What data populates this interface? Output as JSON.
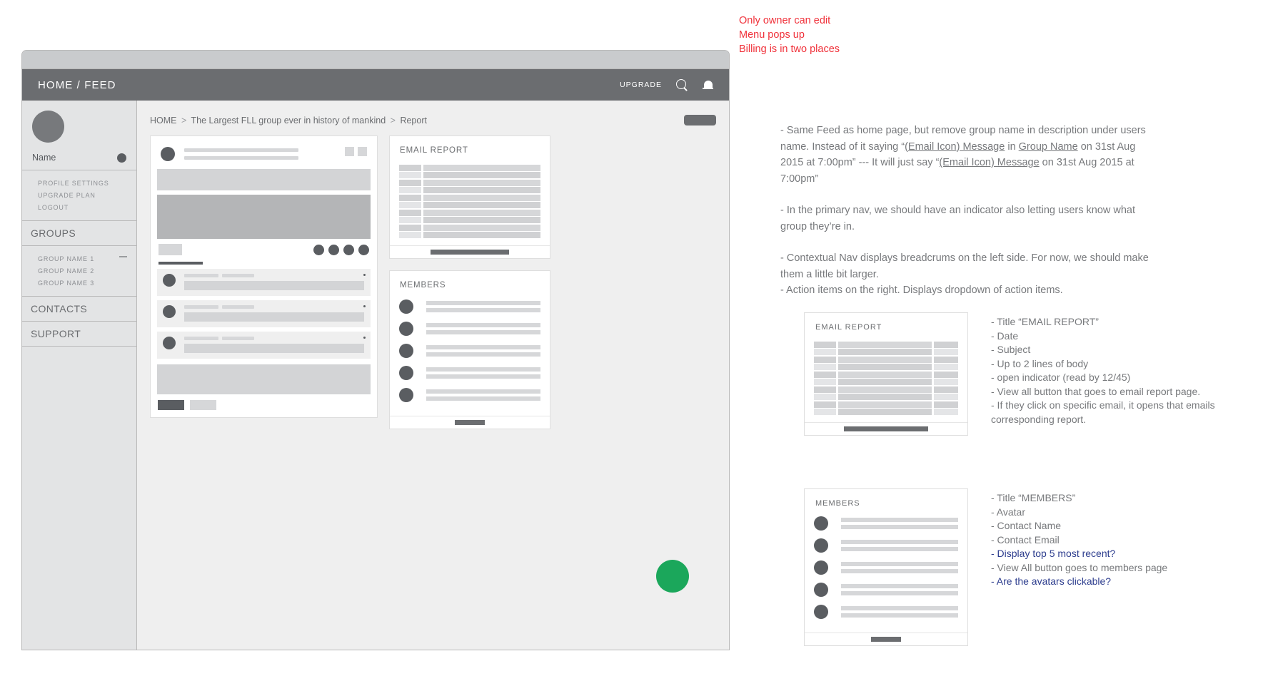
{
  "wireframe": {
    "topbar": {
      "title": "HOME / FEED",
      "upgrade_label": "UPGRADE",
      "search_icon": "search-icon",
      "bell_icon": "bell-icon"
    },
    "sidebar": {
      "profile_name": "Name",
      "account_links": [
        "PROFILE SETTINGS",
        "UPGRADE PLAN",
        "LOGOUT"
      ],
      "groups_heading": "GROUPS",
      "groups": [
        "GROUP NAME 1",
        "GROUP NAME 2",
        "GROUP NAME 3"
      ],
      "sections": [
        "CONTACTS",
        "SUPPORT"
      ]
    },
    "breadcrumb": {
      "home": "HOME",
      "sep": ">",
      "group": "The Largest FLL group ever in history of mankind",
      "page": "Report"
    },
    "panels": {
      "email_report_title": "EMAIL REPORT",
      "members_title": "MEMBERS",
      "email_report_rows": 5,
      "members_rows": 5
    },
    "feed": {
      "comments": 3,
      "reactions": 4
    },
    "fab_color": "#1ba75b"
  },
  "annotations": {
    "red_notes": [
      "Only owner can edit",
      "Menu pops up",
      "Billing is in two places"
    ],
    "main_notes": {
      "p1_a": "- Same Feed as home page, but remove group name in description under users name. Instead of it saying “",
      "p1_u1": "(Email Icon) Message",
      "p1_b": " in ",
      "p1_u2": "Group Name",
      "p1_c": " on 31st Aug 2015 at 7:00pm” --- It will just say “",
      "p1_u3": "(Email Icon) Message",
      "p1_d": " on 31st Aug 2015 at 7:00pm”",
      "p2": "- In the primary nav, we should have an indicator also letting users know what group they’re in.",
      "p3": "- Contextual Nav displays breadcrums on the left side. For now, we should make them a little bit larger.",
      "p4": "- Action items on the right. Displays dropdown of action items."
    },
    "email_report_callout": {
      "card_title": "EMAIL REPORT",
      "items": [
        {
          "text": "- Title “EMAIL REPORT”",
          "highlight": false
        },
        {
          "text": "- Date",
          "highlight": false
        },
        {
          "text": "- Subject",
          "highlight": false
        },
        {
          "text": "- Up to 2 lines of body",
          "highlight": false
        },
        {
          "text": "- open indicator (read by 12/45)",
          "highlight": false
        },
        {
          "text": "- View all button that goes to email report page.",
          "highlight": false
        },
        {
          "text": "- If they click on specific email, it opens that emails corresponding report.",
          "highlight": false
        }
      ]
    },
    "members_callout": {
      "card_title": "MEMBERS",
      "items": [
        {
          "text": "- Title “MEMBERS”",
          "highlight": false
        },
        {
          "text": "- Avatar",
          "highlight": false
        },
        {
          "text": "- Contact Name",
          "highlight": false
        },
        {
          "text": "- Contact Email",
          "highlight": false
        },
        {
          "text": "- Display top 5 most recent?",
          "highlight": true
        },
        {
          "text": "- View All button goes to members page",
          "highlight": false
        },
        {
          "text": "- Are the avatars clickable?",
          "highlight": true
        }
      ]
    }
  },
  "colors": {
    "red": "#f0313a",
    "blue": "#2d3d8e",
    "green": "#1ba75b",
    "dark_gray": "#6b6d70"
  }
}
